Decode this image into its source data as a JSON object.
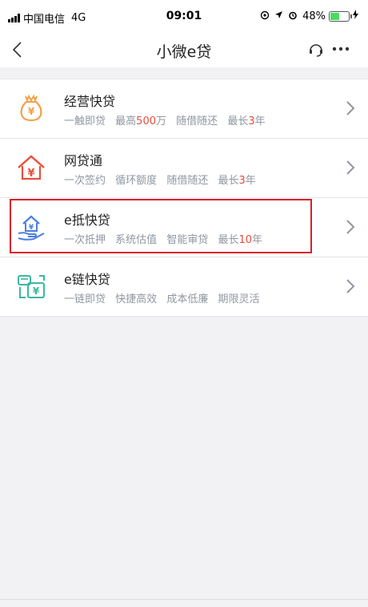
{
  "status_bar": {
    "carrier": "中国电信",
    "network": "4G",
    "time": "09:01",
    "battery": "48%",
    "battery_level": 0.48,
    "battery_color": "#4cd964"
  },
  "nav": {
    "title": "小微e贷",
    "back_icon": "chevron-left-icon",
    "headset_icon": "headset-icon",
    "more_icon": "more-dots-icon"
  },
  "items": [
    {
      "title": "经营快贷",
      "icon": "money-bag-icon",
      "desc": {
        "s1": "一触即贷",
        "s2_pre": "最高",
        "s2_hl": "500",
        "s2_post": "万",
        "s3": "随借随还",
        "s4_pre": "最长",
        "s4_hl": "3",
        "s4_post": "年"
      }
    },
    {
      "title": "网贷通",
      "icon": "house-yen-icon",
      "desc": {
        "s1": "一次签约",
        "s2": "循环额度",
        "s3": "随借随还",
        "s4_pre": "最长",
        "s4_hl": "3",
        "s4_post": "年"
      }
    },
    {
      "title": "e抵快贷",
      "icon": "hand-house-icon",
      "highlighted": true,
      "desc": {
        "s1": "一次抵押",
        "s2": "系统估值",
        "s3": "智能审贷",
        "s4_pre": "最长",
        "s4_hl": "10",
        "s4_post": "年"
      }
    },
    {
      "title": "e链快贷",
      "icon": "chain-card-icon",
      "desc": {
        "s1": "一链即贷",
        "s2": "快捷高效",
        "s3": "成本低廉",
        "s4": "期限灵活"
      }
    }
  ],
  "colors": {
    "accent_red": "#e84c3d",
    "highlight_border": "#d8202b",
    "icon_orange": "#f0a24b",
    "icon_red": "#e8503c",
    "icon_blue": "#4a7fe0",
    "icon_teal": "#3bb8a0"
  }
}
